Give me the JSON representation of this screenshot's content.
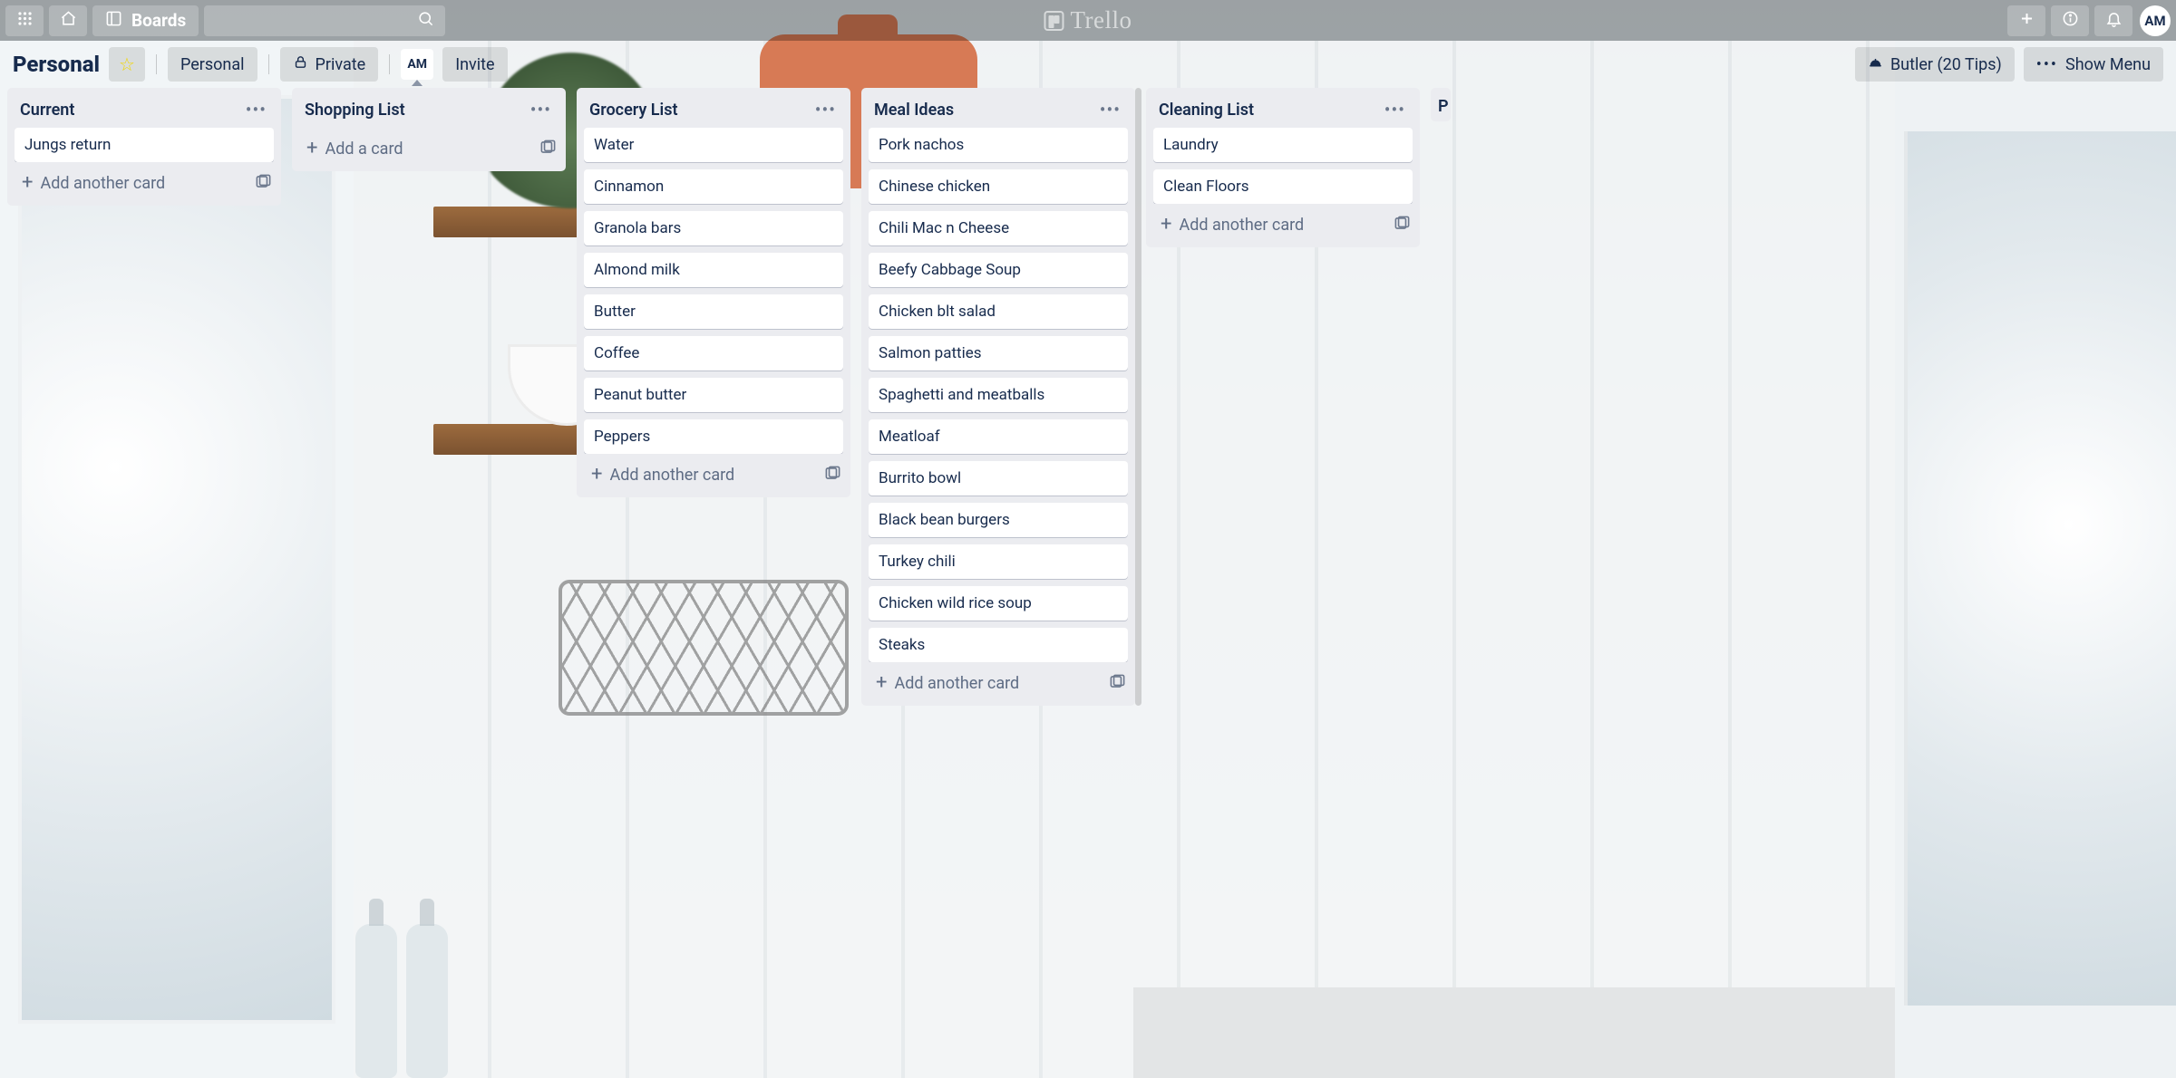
{
  "topbar": {
    "boards_label": "Boards",
    "logo_text": "Trello",
    "avatar_initials": "AM"
  },
  "board_header": {
    "title": "Personal",
    "team_label": "Personal",
    "visibility_label": "Private",
    "member_initials": "AM",
    "invite_label": "Invite",
    "butler_label": "Butler (20 Tips)",
    "show_menu_label": "Show Menu"
  },
  "strings": {
    "add_a_card": "Add a card",
    "add_another_card": "Add another card"
  },
  "lists": [
    {
      "title": "Current",
      "add_label_key": "add_another_card",
      "cards": [
        "Jungs return"
      ]
    },
    {
      "title": "Shopping List",
      "add_label_key": "add_a_card",
      "cards": []
    },
    {
      "title": "Grocery List",
      "add_label_key": "add_another_card",
      "cards": [
        "Water",
        "Cinnamon",
        "Granola bars",
        "Almond milk",
        "Butter",
        "Coffee",
        "Peanut butter",
        "Peppers"
      ]
    },
    {
      "title": "Meal Ideas",
      "add_label_key": "add_another_card",
      "has_scroll": true,
      "cards": [
        "Pork nachos",
        "Chinese chicken",
        "Chili Mac n Cheese",
        "Beefy Cabbage Soup",
        "Chicken blt salad",
        "Salmon patties",
        "Spaghetti and meatballs",
        "Meatloaf",
        "Burrito bowl",
        "Black bean burgers",
        "Turkey chili",
        "Chicken wild rice soup",
        "Steaks"
      ]
    },
    {
      "title": "Cleaning List",
      "add_label_key": "add_another_card",
      "cards": [
        "Laundry",
        "Clean Floors"
      ]
    },
    {
      "title": "P",
      "peek": true,
      "cards": []
    }
  ]
}
